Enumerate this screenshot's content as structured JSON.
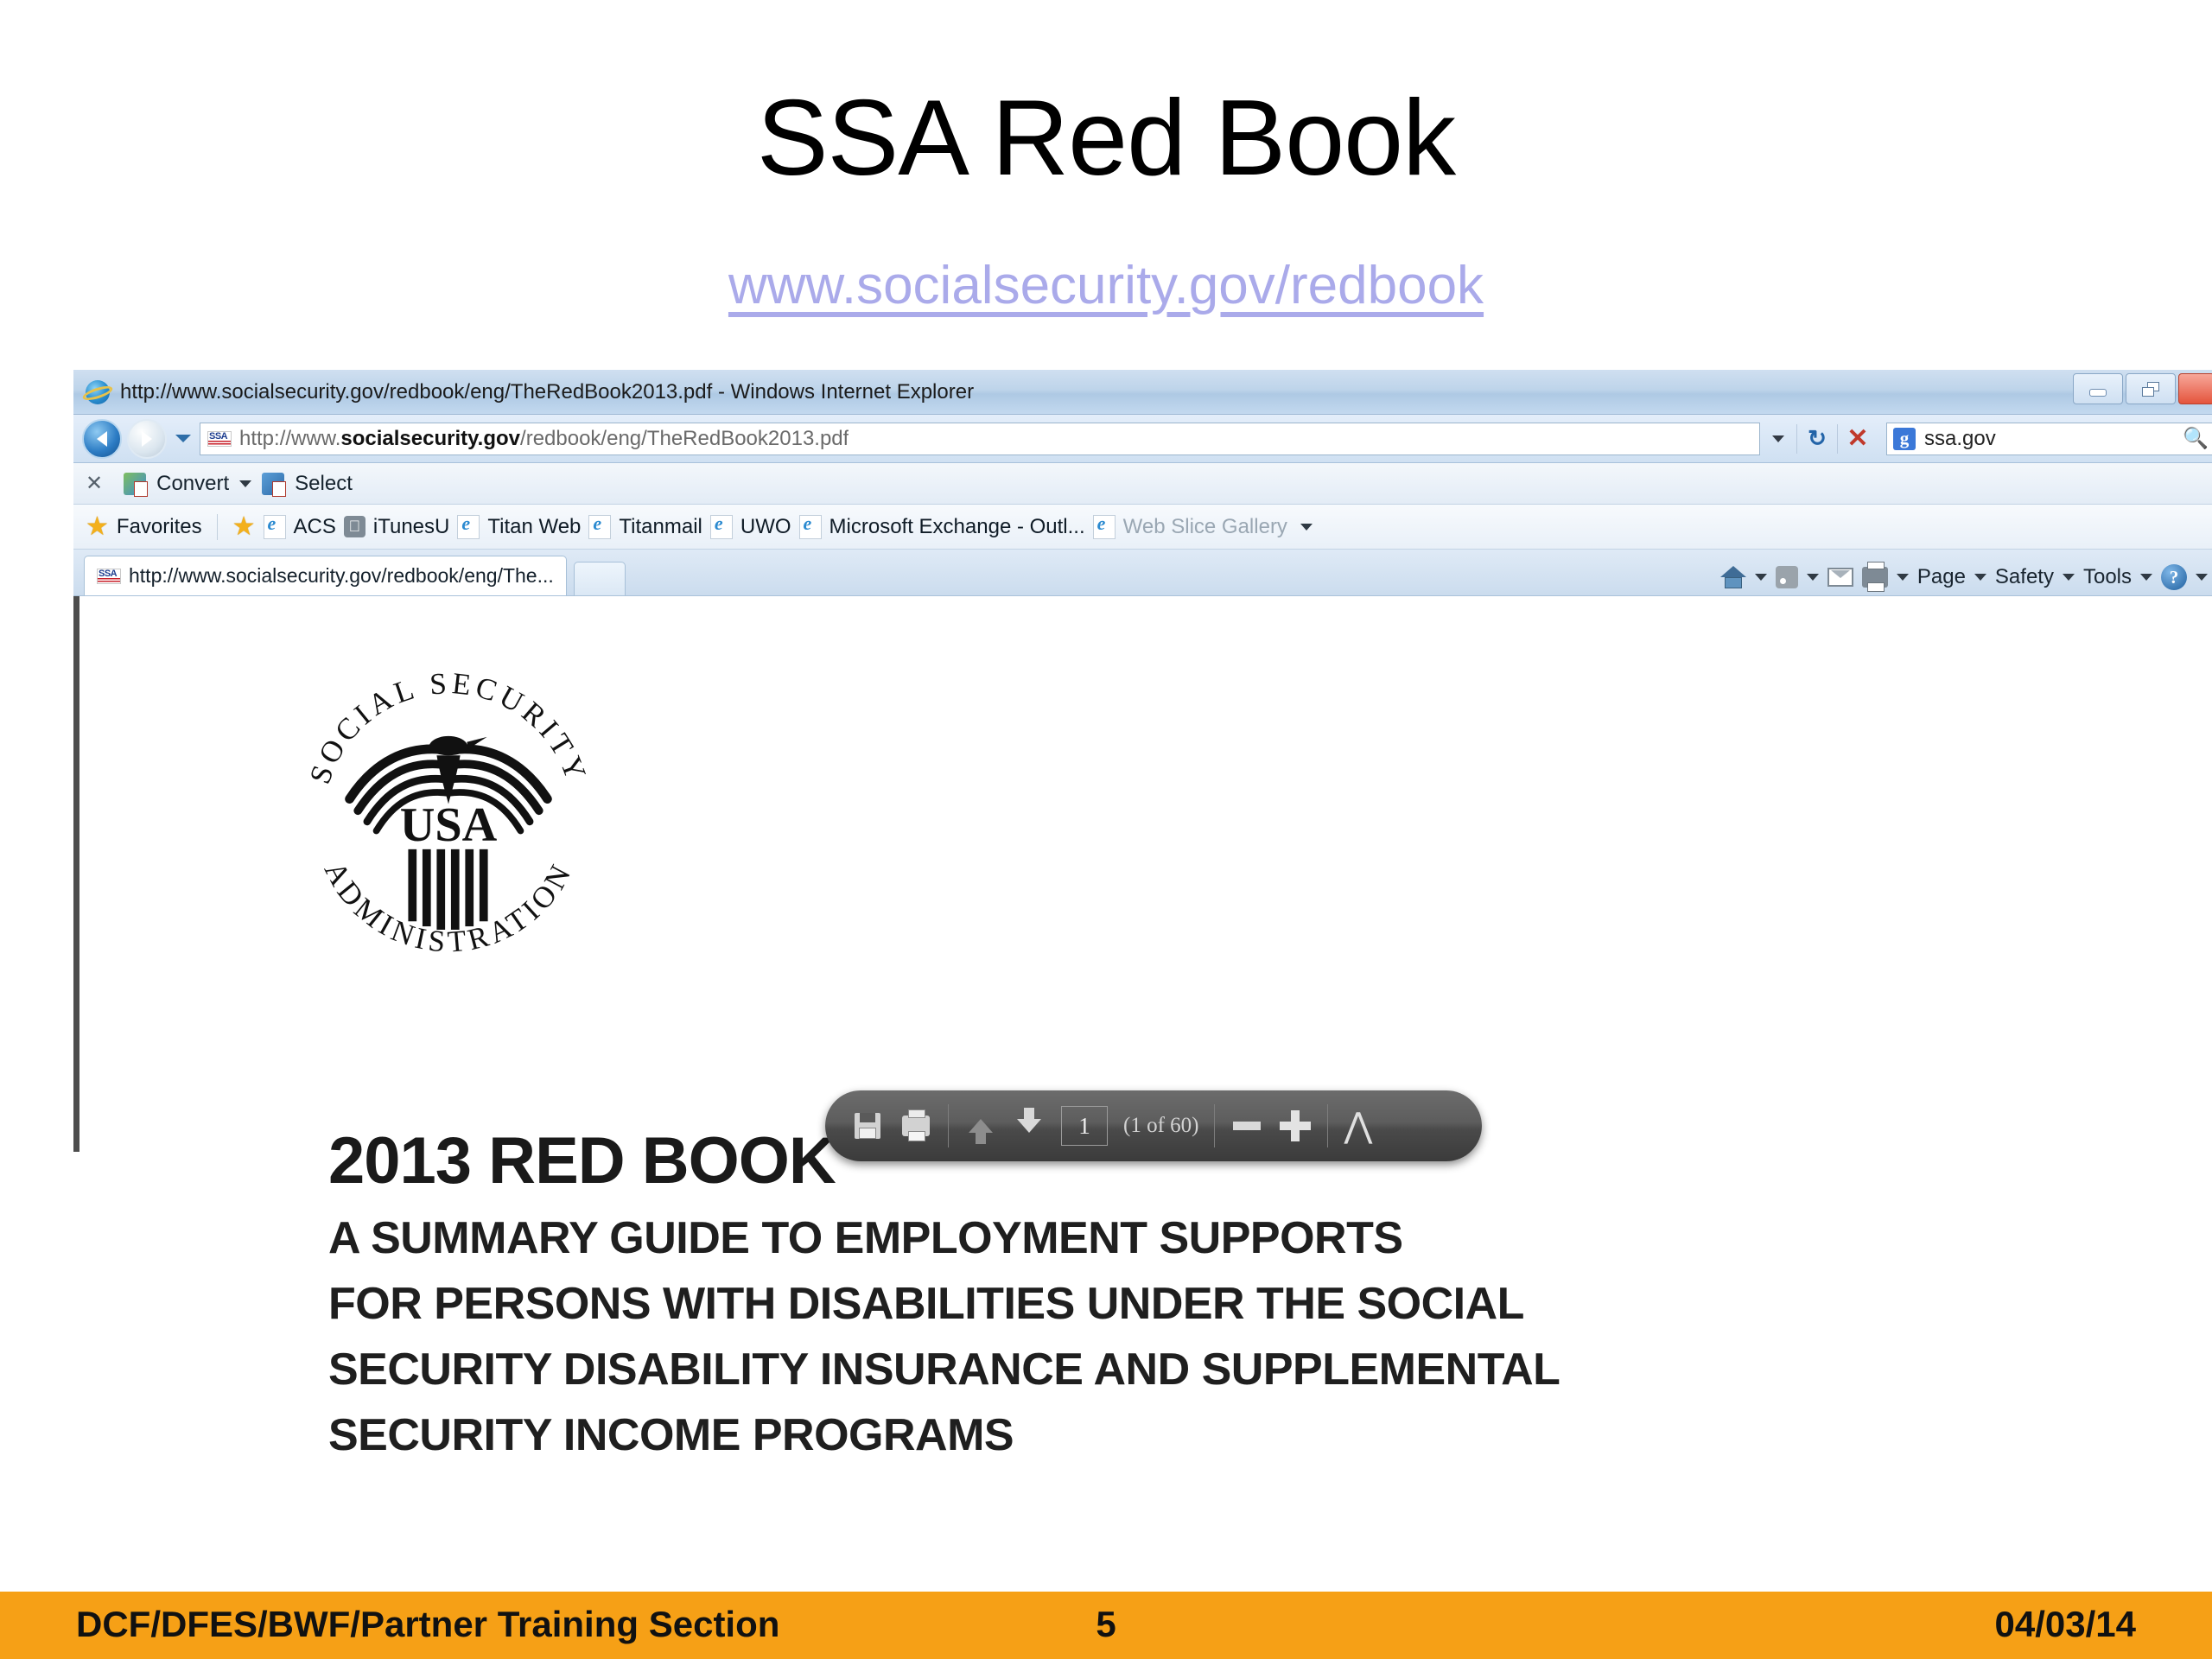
{
  "slide": {
    "title": "SSA Red Book",
    "link": "www.socialsecurity.gov/redbook",
    "link_color": "#aaaaea"
  },
  "browser": {
    "window_title": "http://www.socialsecurity.gov/redbook/eng/TheRedBook2013.pdf - Windows Internet Explorer",
    "icon": "internet-explorer-icon",
    "window_controls": [
      {
        "name": "minimize-button",
        "glyph": "minimize-icon"
      },
      {
        "name": "restore-button",
        "glyph": "restore-icon"
      },
      {
        "name": "close-button",
        "glyph": "close-icon"
      }
    ],
    "nav": {
      "back": "back-icon",
      "forward": "forward-icon",
      "recent_pages": "chevron-down-icon"
    },
    "address": {
      "favicon": "ssa-favicon",
      "prefix": "http://www.",
      "domain": "socialsecurity.gov",
      "path": "/redbook/eng/TheRedBook2013.pdf",
      "dropdown": "chevron-down-icon",
      "refresh": "refresh-icon",
      "stop": "stop-icon"
    },
    "search": {
      "provider_icon": "google-icon",
      "value": "ssa.gov",
      "magnifier": "search-icon"
    },
    "convert_bar": {
      "close": "close-icon",
      "convert_label": "Convert",
      "convert_caret": "chevron-down-icon",
      "select_label": "Select"
    },
    "favorites_bar": {
      "favorites_label": "Favorites",
      "items": [
        {
          "label": "ACS",
          "icon": "ie-page-icon"
        },
        {
          "label": "iTunesU",
          "icon": "apple-icon"
        },
        {
          "label": "Titan Web",
          "icon": "ie-page-icon"
        },
        {
          "label": "Titanmail",
          "icon": "ie-page-icon"
        },
        {
          "label": "UWO",
          "icon": "ie-page-icon"
        },
        {
          "label": "Microsoft Exchange - Outl...",
          "icon": "ie-page-icon"
        },
        {
          "label": "Web Slice Gallery",
          "icon": "ie-page-icon",
          "dimmed": true
        }
      ],
      "overflow_caret": "chevron-down-icon"
    },
    "tabs": {
      "active_tab_label": "http://www.socialsecurity.gov/redbook/eng/The...",
      "active_tab_icon": "ssa-favicon",
      "new_tab": "new-tab-button"
    },
    "command_bar": [
      {
        "name": "home-button",
        "icon": "home-icon",
        "label": "",
        "caret": true
      },
      {
        "name": "feeds-button",
        "icon": "rss-icon",
        "label": "",
        "caret": true
      },
      {
        "name": "read-mail-button",
        "icon": "mail-icon",
        "label": "",
        "caret": false
      },
      {
        "name": "print-button",
        "icon": "printer-icon",
        "label": "",
        "caret": true
      },
      {
        "name": "page-menu",
        "icon": "",
        "label": "Page",
        "caret": true
      },
      {
        "name": "safety-menu",
        "icon": "",
        "label": "Safety",
        "caret": true
      },
      {
        "name": "tools-menu",
        "icon": "",
        "label": "Tools",
        "caret": true
      },
      {
        "name": "help-menu",
        "icon": "help-icon",
        "label": "",
        "caret": true
      }
    ]
  },
  "pdf": {
    "seal_alt": "social-security-administration-seal",
    "seal_text_top": "SOCIAL SECURITY",
    "seal_text_bottom": "ADMINISTRATION",
    "seal_center": "USA",
    "title": "2013 RED BOOK",
    "subtitle_lines": [
      "A SUMMARY GUIDE TO EMPLOYMENT SUPPORTS",
      "FOR PERSONS WITH DISABILITIES UNDER THE SOCIAL",
      "SECURITY DISABILITY INSURANCE AND SUPPLEMENTAL",
      "SECURITY INCOME PROGRAMS"
    ],
    "toolbar": {
      "save_icon": "save-icon",
      "print_icon": "print-icon",
      "prev_page_icon": "arrow-up-icon",
      "next_page_icon": "arrow-down-icon",
      "page_number": "1",
      "page_count_label": "(1 of 60)",
      "zoom_out_icon": "minus-icon",
      "zoom_in_icon": "plus-icon",
      "acrobat_icon": "adobe-acrobat-icon"
    }
  },
  "footer": {
    "left": "DCF/DFES/BWF/Partner Training Section",
    "page_number": "5",
    "date": "04/03/14",
    "background": "#f6a016"
  }
}
